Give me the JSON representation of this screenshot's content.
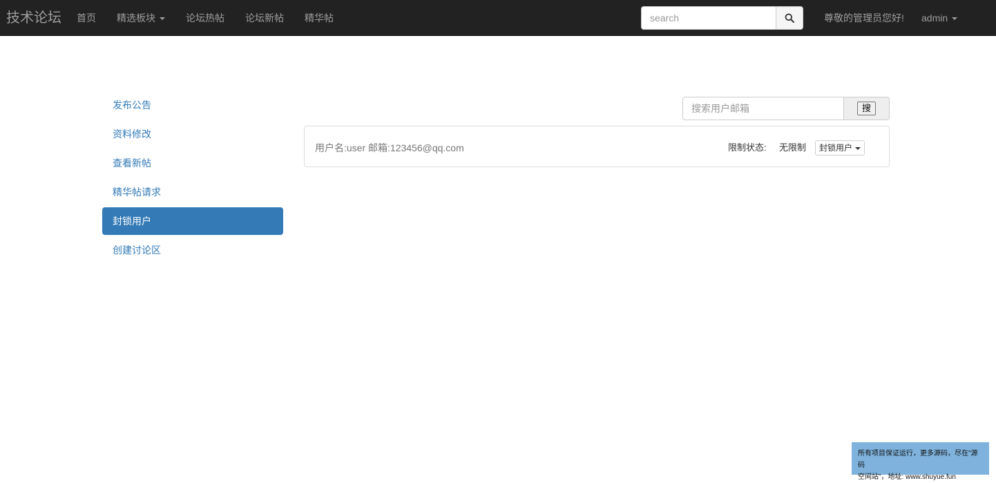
{
  "navbar": {
    "brand": "技术论坛",
    "items": [
      {
        "label": "首页"
      },
      {
        "label": "精选板块"
      },
      {
        "label": "论坛热帖"
      },
      {
        "label": "论坛新帖"
      },
      {
        "label": "精华帖"
      }
    ],
    "search_placeholder": "search",
    "greeting": "尊敬的管理员您好!",
    "user": "admin"
  },
  "sidebar": {
    "items": [
      {
        "label": "发布公告"
      },
      {
        "label": "资料修改"
      },
      {
        "label": "查看新帖"
      },
      {
        "label": "精华帖请求"
      },
      {
        "label": "封锁用户"
      },
      {
        "label": "创建讨论区"
      }
    ],
    "active": "封锁用户"
  },
  "user_search": {
    "placeholder": "搜索用户邮箱",
    "button_label": "搜"
  },
  "result": {
    "user_info": "用户名:user 邮箱:123456@qq.com",
    "status_label": "限制状态:",
    "status_value": "无限制",
    "action_label": "封锁用户"
  },
  "watermark": {
    "line1": "所有项目保证运行，更多源码，尽在\"源码",
    "line2": "空间站\"，地址: www.shuyue.fun"
  },
  "colors": {
    "navbar_bg": "#222222",
    "nav_text": "#9d9d9d",
    "link": "#337ab7",
    "active_bg": "#337ab7",
    "watermark_bg": "#7fb3dd"
  }
}
